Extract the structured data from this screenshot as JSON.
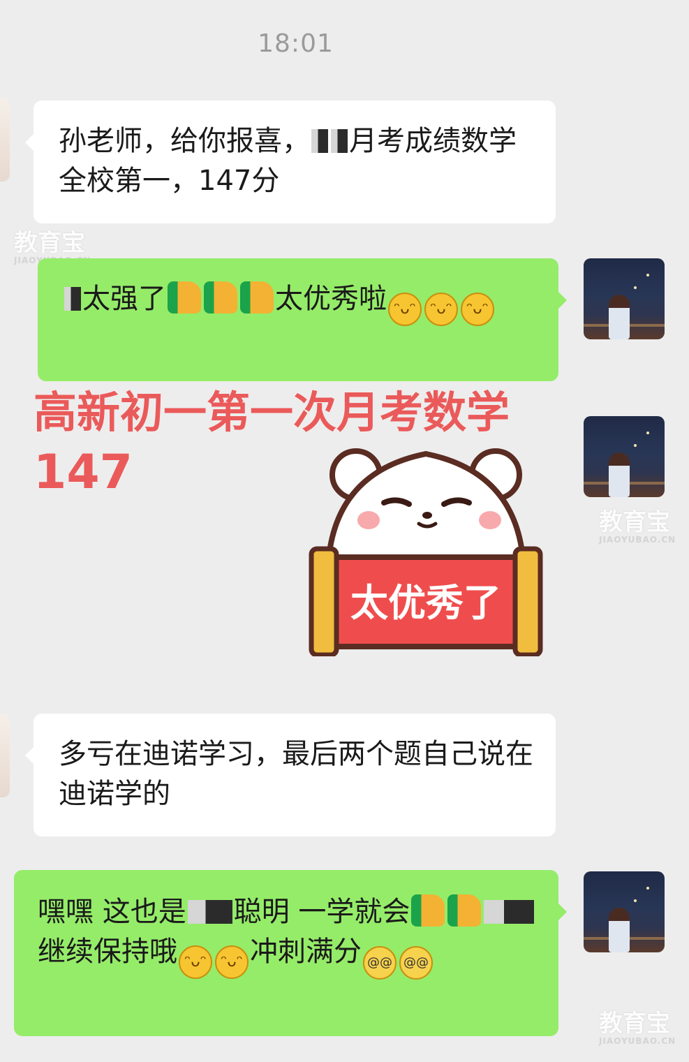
{
  "status": {
    "time": "18:01"
  },
  "messages": [
    {
      "side": "left",
      "text_a": "孙老师，给你报喜，",
      "text_b": "月考成绩数学全校第一，147分"
    },
    {
      "side": "right",
      "text_a": "太强了",
      "text_b": "太优秀啦"
    },
    {
      "side": "left",
      "text": "多亏在迪诺学习，最后两个题自己说在迪诺学的"
    },
    {
      "side": "right",
      "text_a": "嘿嘿 这也是",
      "text_b": "聪明 一学就会",
      "text_c": "继续保持哦",
      "text_d": "冲刺满",
      "text_e": "分"
    }
  ],
  "overlay": {
    "line1": "高新初一第一次月考数学",
    "line2": "147"
  },
  "sticker": {
    "label": "太优秀了",
    "description_icon": "bear-sticker"
  },
  "watermark": {
    "main": "教育宝",
    "sub": "JIAOYUBAO.CN"
  },
  "colors": {
    "green_bubble": "#95ec69",
    "white_bubble": "#ffffff",
    "background": "#ededed",
    "overlay_red": "#ea5a5a"
  }
}
